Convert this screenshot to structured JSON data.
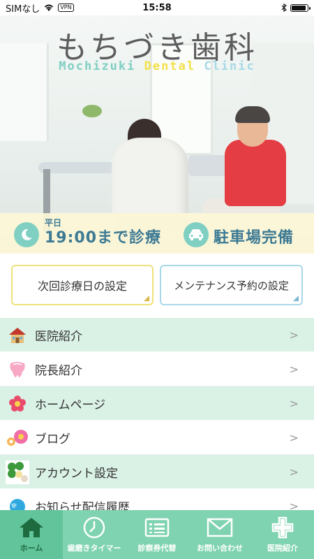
{
  "status_bar": {
    "carrier": "SIMなし",
    "vpn": "VPN",
    "time": "15:58"
  },
  "hero": {
    "title": "もちづき歯科",
    "subtitle_parts": [
      "Mochizuki",
      "Dental",
      "Clinic"
    ]
  },
  "info": {
    "hours_small": "平日",
    "hours_text": "19:00まで診療",
    "parking_text": "駐車場完備"
  },
  "buttons": {
    "next_appointment": "次回診療日の設定",
    "maintenance": "メンテナンス予約の設定"
  },
  "menu": {
    "items": [
      {
        "label": "医院紹介",
        "icon": "house-icon",
        "chevron": ">"
      },
      {
        "label": "院長紹介",
        "icon": "tooth-icon",
        "chevron": ">"
      },
      {
        "label": "ホームページ",
        "icon": "flower-icon",
        "chevron": ">"
      },
      {
        "label": "ブログ",
        "icon": "flowers-icon",
        "chevron": ">"
      },
      {
        "label": "アカウント設定",
        "icon": "clover-icon",
        "chevron": ">"
      },
      {
        "label": "お知らせ配信履歴",
        "icon": "globe-icon",
        "chevron": ">"
      }
    ]
  },
  "tabs": [
    {
      "label": "ホーム",
      "icon": "home-icon",
      "active": true
    },
    {
      "label": "歯磨きタイマー",
      "icon": "timer-icon",
      "active": false
    },
    {
      "label": "診察券代替",
      "icon": "card-icon",
      "active": false
    },
    {
      "label": "お問い合わせ",
      "icon": "mail-icon",
      "active": false
    },
    {
      "label": "医院紹介",
      "icon": "cross-icon",
      "active": false
    }
  ],
  "colors": {
    "accent_green": "#7fd3b0",
    "active_tab": "#62c49b",
    "active_tab_text": "#1d6b3f",
    "menu_green": "#daf1e6",
    "info_text": "#3d7a94",
    "doctor_shirt": "#e43d43"
  }
}
